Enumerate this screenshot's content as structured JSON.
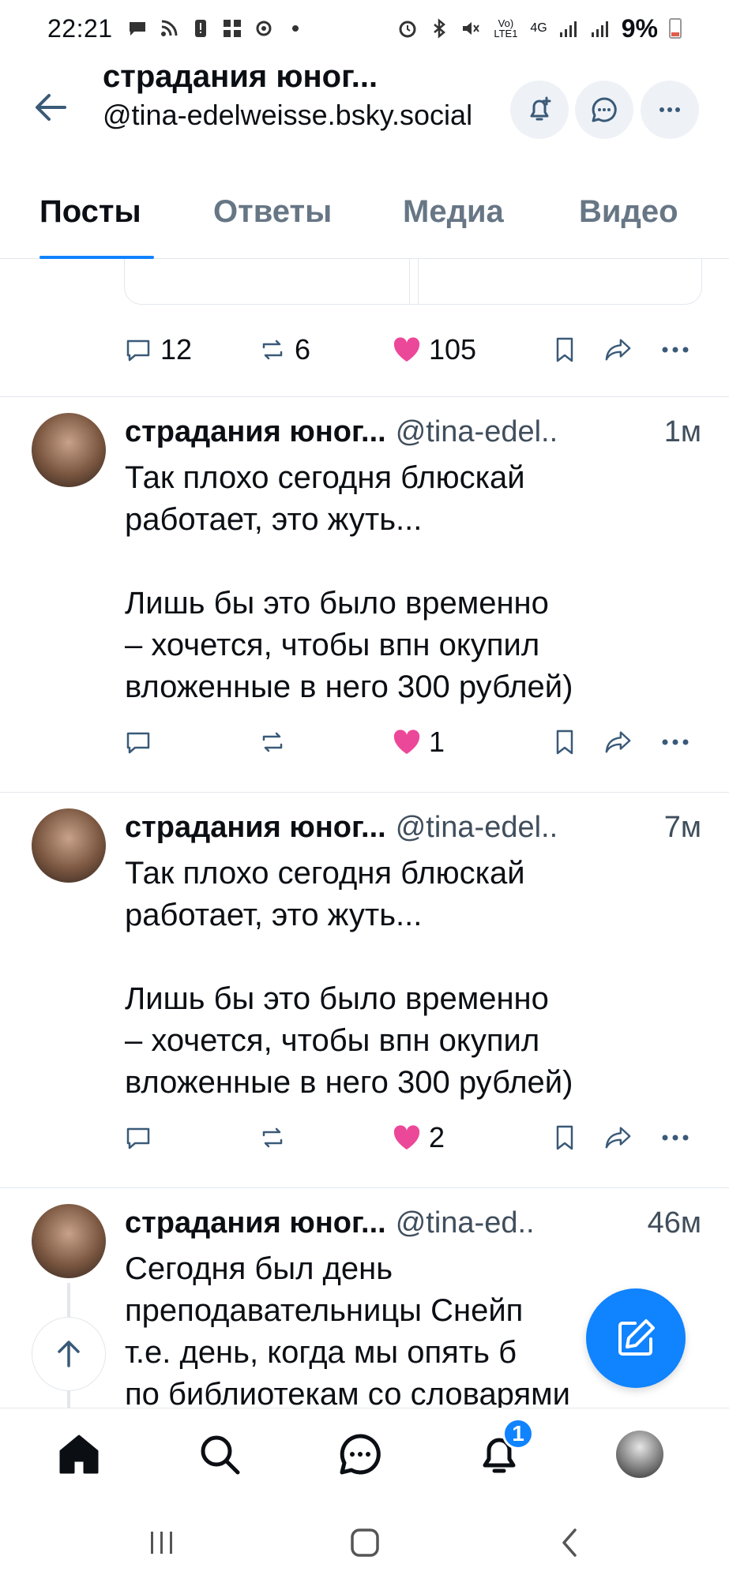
{
  "status_bar": {
    "time": "22:21",
    "network_label": "Vo) LTE1",
    "network_type": "4G",
    "battery": "9%"
  },
  "header": {
    "display_name": "страдания юног...",
    "handle": "@tina-edelweisse.bsky.social",
    "icons": [
      "back-arrow-icon",
      "bell-plus-icon",
      "chat-bubble-icon",
      "more-horizontal-icon"
    ]
  },
  "tabs": [
    {
      "label": "Посты",
      "active": true
    },
    {
      "label": "Ответы",
      "active": false
    },
    {
      "label": "Медиа",
      "active": false
    },
    {
      "label": "Видео",
      "active": false
    }
  ],
  "prev_post_actions": {
    "replies": "12",
    "reposts": "6",
    "likes": "105"
  },
  "posts": [
    {
      "name": "страдания юног...",
      "handle": "@tina-edel..",
      "time": "1м",
      "text": "Так плохо сегодня блюскай\nработает, это жуть...\n\nЛишь бы это было временно\n– хочется, чтобы впн окупил\nвложенные в него 300 рублей)",
      "replies": "",
      "reposts": "",
      "likes": "1"
    },
    {
      "name": "страдания юног...",
      "handle": "@tina-edel..",
      "time": "7м",
      "text": "Так плохо сегодня блюскай\nработает, это жуть...\n\nЛишь бы это было временно\n– хочется, чтобы впн окупил\nвложенные в него 300 рублей)",
      "replies": "",
      "reposts": "",
      "likes": "2"
    },
    {
      "name": "страдания юног...",
      "handle": "@tina-ed..",
      "time": "46м",
      "text": "Сегодня был день\nпреподавательницы Снейп\nт.е. день, когда мы опять б\nпо библиотекам со словарями"
    }
  ],
  "bottom_nav": {
    "notifications_badge": "1"
  },
  "colors": {
    "accent": "#1083fe",
    "like": "#ec4899",
    "text": "#0b0f14",
    "muted": "#404e5c",
    "border": "#e3e7ec"
  }
}
